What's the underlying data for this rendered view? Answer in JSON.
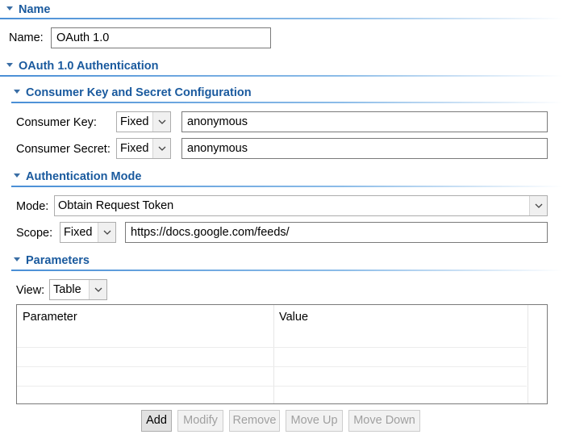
{
  "sections": {
    "name": "Name",
    "oauth": "OAuth 1.0 Authentication",
    "consumer": "Consumer Key and Secret Configuration",
    "auth_mode": "Authentication Mode",
    "parameters": "Parameters"
  },
  "name_row": {
    "label": "Name:",
    "value": "OAuth 1.0"
  },
  "consumer_key": {
    "label": "Consumer Key:",
    "type": "Fixed",
    "value": "anonymous"
  },
  "consumer_secret": {
    "label": "Consumer Secret:",
    "type": "Fixed",
    "value": "anonymous"
  },
  "mode": {
    "label": "Mode:",
    "value": "Obtain Request Token"
  },
  "scope": {
    "label": "Scope:",
    "type": "Fixed",
    "value": "https://docs.google.com/feeds/"
  },
  "view": {
    "label": "View:",
    "value": "Table"
  },
  "table": {
    "columns": [
      "Parameter",
      "Value"
    ]
  },
  "buttons": {
    "add": "Add",
    "modify": "Modify",
    "remove": "Remove",
    "move_up": "Move Up",
    "move_down": "Move Down"
  },
  "colors": {
    "section_title": "#1a5a9e",
    "section_rule": "#4a8fd6"
  },
  "icons": {
    "collapse": "triangle-down-icon",
    "dropdown": "chevron-down-icon"
  }
}
